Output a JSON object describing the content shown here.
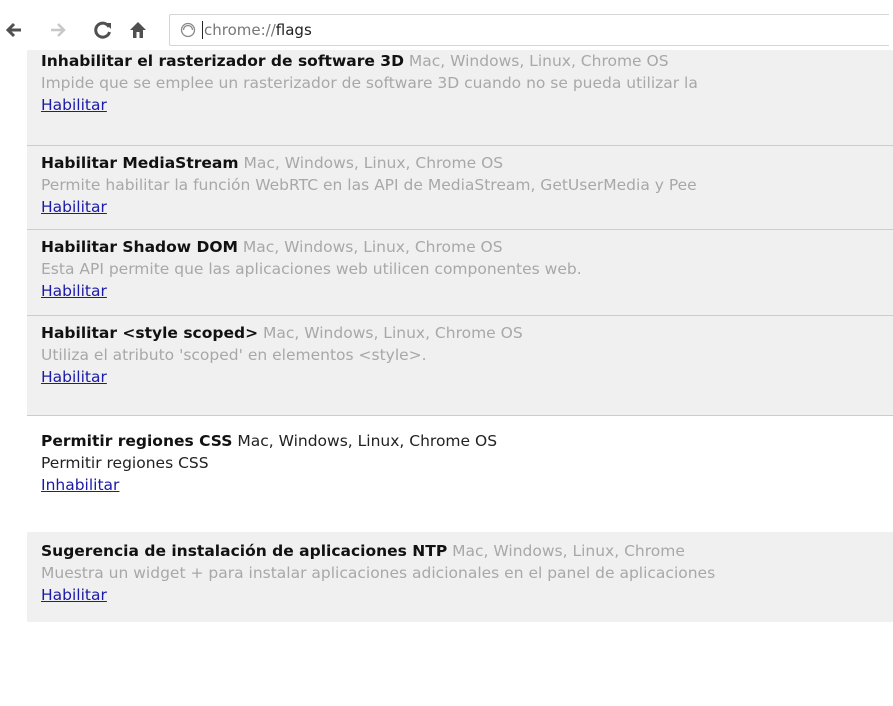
{
  "toolbar": {
    "url_prefix": "chrome://",
    "url_host": "flags"
  },
  "flags": [
    {
      "title": "Inhabilitar el rasterizador de software 3D",
      "platforms": "Mac, Windows, Linux, Chrome OS",
      "description": "Impide que se emplee un rasterizador de software 3D cuando no se pueda utilizar la",
      "link": "Habilitar"
    },
    {
      "title": "Habilitar MediaStream",
      "platforms": "Mac, Windows, Linux, Chrome OS",
      "description": "Permite habilitar la función WebRTC en las API de MediaStream, GetUserMedia y Pee",
      "link": "Habilitar"
    },
    {
      "title": "Habilitar Shadow DOM",
      "platforms": "Mac, Windows, Linux, Chrome OS",
      "description": "Esta API permite que las aplicaciones web utilicen componentes web.",
      "link": "Habilitar"
    },
    {
      "title": "Habilitar <style scoped>",
      "platforms": "Mac, Windows, Linux, Chrome OS",
      "description": "Utiliza el atributo 'scoped' en elementos <style>.",
      "link": "Habilitar"
    },
    {
      "title": "Permitir regiones CSS",
      "platforms": "Mac, Windows, Linux, Chrome OS",
      "description": "Permitir regiones CSS",
      "link": "Inhabilitar"
    },
    {
      "title": "Sugerencia de instalación de aplicaciones NTP",
      "platforms": "Mac, Windows, Linux, Chrome",
      "description": "Muestra un widget + para instalar aplicaciones adicionales en el panel de aplicaciones",
      "link": "Habilitar"
    }
  ]
}
